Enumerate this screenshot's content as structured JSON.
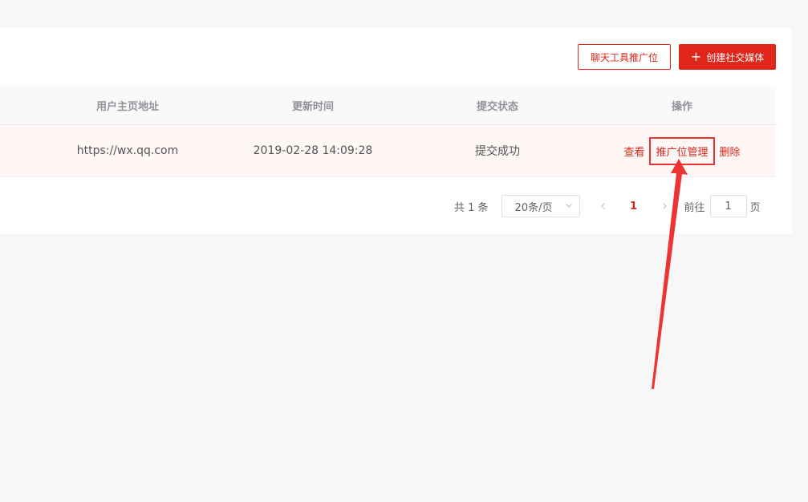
{
  "toolbar": {
    "chat_promo_label": "聊天工具推广位",
    "create_label": "创建社交媒体",
    "create_icon": "plus-icon"
  },
  "table": {
    "columns": [
      "用户主页地址",
      "更新时间",
      "提交状态",
      "操作"
    ],
    "rows": [
      {
        "url": "https://wx.qq.com",
        "updated": "2019-02-28 14:09:28",
        "status": "提交成功",
        "actions": [
          "查看",
          "推广位管理",
          "删除"
        ]
      }
    ]
  },
  "pagination": {
    "total_text": "共 1 条",
    "page_size": "20条/页",
    "current_page": "1",
    "goto_label": "前往",
    "goto_value": "1",
    "page_suffix": "页"
  },
  "colors": {
    "accent": "#e0251b",
    "annotation": "#ec3434"
  }
}
